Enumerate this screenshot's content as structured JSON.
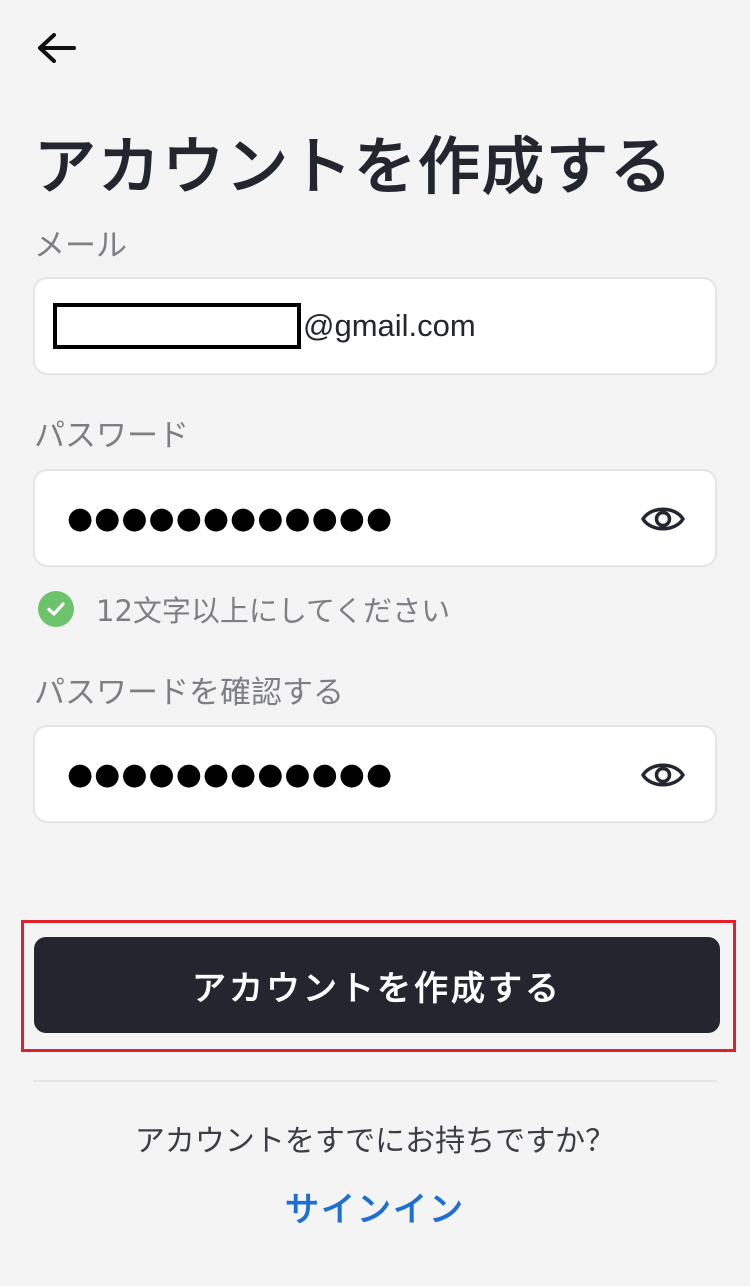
{
  "header": {
    "back_icon": "arrow-left-icon",
    "title": "アカウントを作成する"
  },
  "email": {
    "label": "メール",
    "value_suffix": "@gmail.com"
  },
  "password": {
    "label": "パスワード",
    "value_masked": "●●●●●●●●●●●●",
    "toggle_icon": "eye-icon"
  },
  "password_hint": {
    "icon": "check-circle-icon",
    "text": "12文字以上にしてください",
    "color": "#6cc36c"
  },
  "confirm_password": {
    "label": "パスワードを確認する",
    "value_masked": "●●●●●●●●●●●●",
    "toggle_icon": "eye-icon"
  },
  "actions": {
    "create_label": "アカウントを作成する",
    "highlight_color": "#e0202a",
    "button_color": "#23262f"
  },
  "footer": {
    "already_text": "アカウントをすでにお持ちですか？",
    "signin_label": "サインイン",
    "link_color": "#1d6fd6"
  }
}
